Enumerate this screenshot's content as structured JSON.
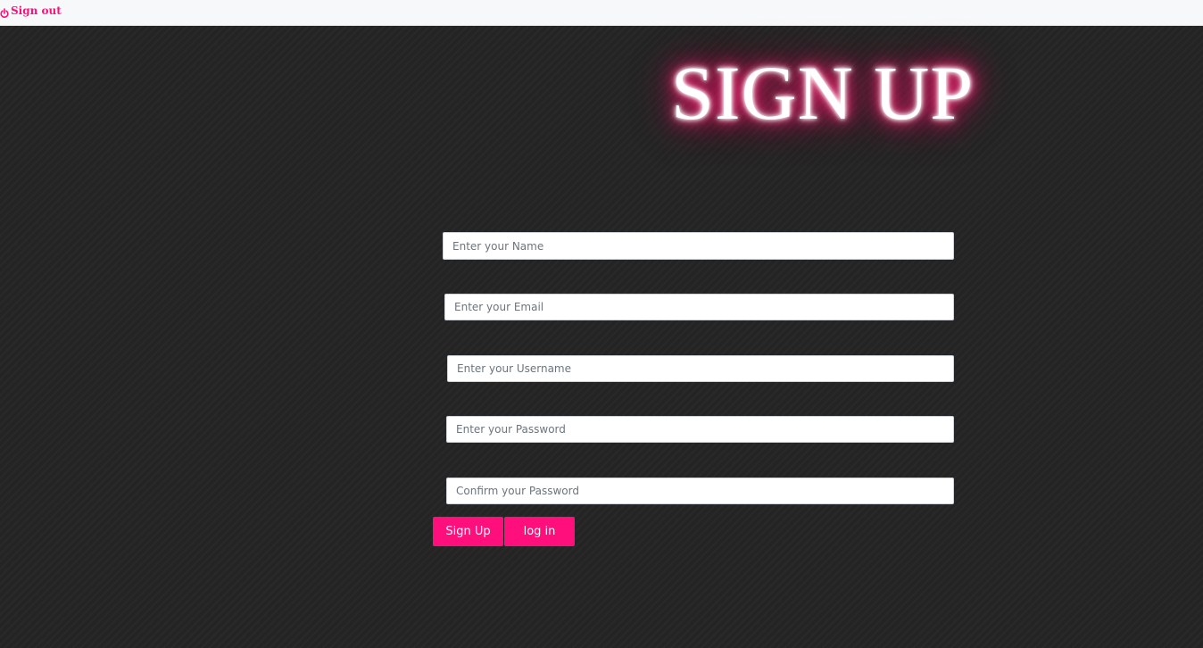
{
  "colors": {
    "accent": "#ff0f7b",
    "glow": "#ff1a6e",
    "topbar_bg": "#f7f8fa",
    "page_bg": "#242424"
  },
  "topbar": {
    "signout_label": "Sign out",
    "signout_icon": "power-icon"
  },
  "page": {
    "title": "SIGN UP"
  },
  "form": {
    "name": {
      "placeholder": "Enter your Name",
      "value": ""
    },
    "email": {
      "placeholder": "Enter your Email",
      "value": ""
    },
    "username": {
      "placeholder": "Enter your Username",
      "value": ""
    },
    "password": {
      "placeholder": "Enter your Password",
      "value": ""
    },
    "confirm_password": {
      "placeholder": "Confirm your Password",
      "value": ""
    },
    "signup_button_label": "Sign Up",
    "login_button_label": "log in"
  }
}
